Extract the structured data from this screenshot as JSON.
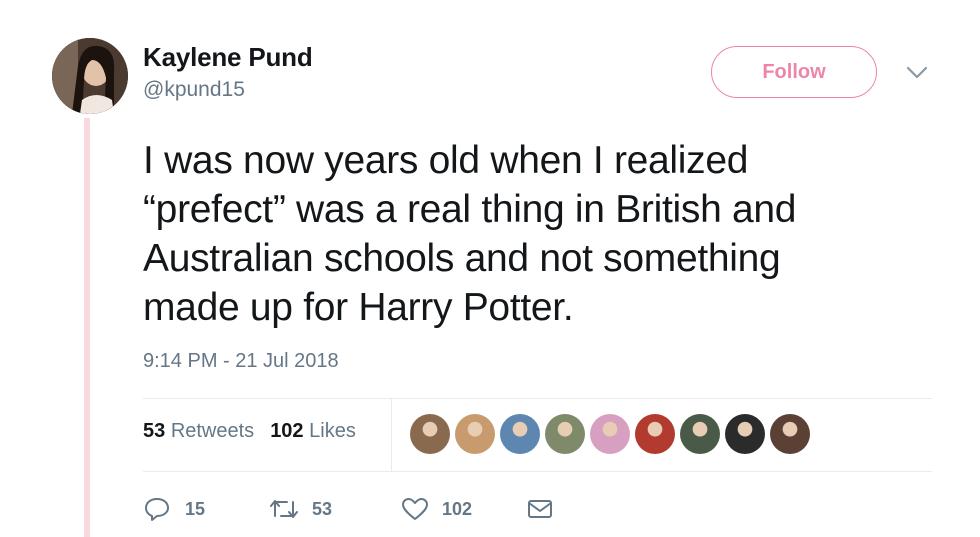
{
  "author": {
    "display_name": "Kaylene Pund",
    "handle": "@kpund15"
  },
  "follow_label": "Follow",
  "tweet": {
    "lines": [
      "I was now years old when I realized",
      "“prefect” was a real thing in British and",
      "Australian schools and not something",
      "made up for Harry Potter."
    ],
    "timestamp": "9:14 PM - 21 Jul 2018"
  },
  "stats": {
    "retweets_count": "53",
    "retweets_label": "Retweets",
    "likes_count": "102",
    "likes_label": "Likes"
  },
  "liker_avatars": [
    {
      "name": "liker-avatar-1",
      "color": "#8a6a4f"
    },
    {
      "name": "liker-avatar-2",
      "color": "#c89b6e"
    },
    {
      "name": "liker-avatar-3",
      "color": "#5d86b0"
    },
    {
      "name": "liker-avatar-4",
      "color": "#7f8a6a"
    },
    {
      "name": "liker-avatar-5",
      "color": "#d8a0c0"
    },
    {
      "name": "liker-avatar-6",
      "color": "#b23a2e"
    },
    {
      "name": "liker-avatar-7",
      "color": "#4a5a48"
    },
    {
      "name": "liker-avatar-8",
      "color": "#2b2b2b"
    },
    {
      "name": "liker-avatar-9",
      "color": "#5b4036"
    }
  ],
  "actions": {
    "reply_count": "15",
    "retweet_count": "53",
    "like_count": "102"
  },
  "colors": {
    "accent": "#e0245e",
    "secondary_text": "#657786",
    "thread_line": "#f7d9df"
  }
}
